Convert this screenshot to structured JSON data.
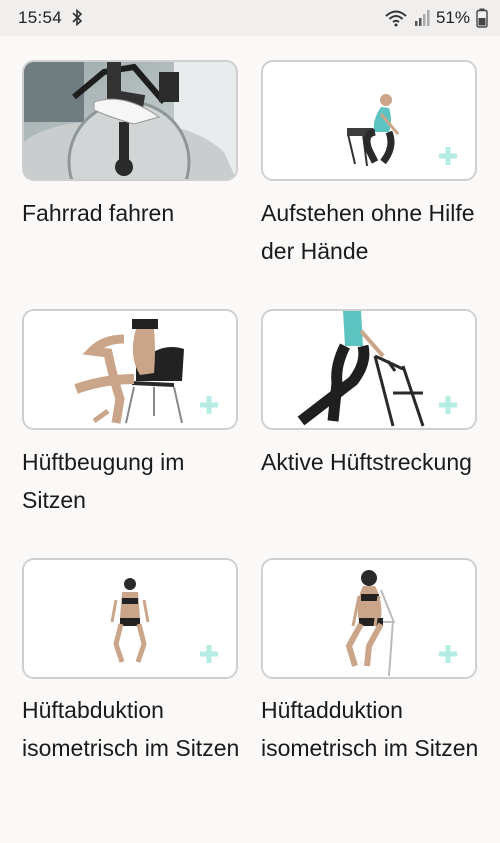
{
  "status_bar": {
    "time": "15:54",
    "battery_percent": "51%",
    "icons": [
      "bluetooth-icon",
      "wifi-icon",
      "signal-icon",
      "battery-icon"
    ]
  },
  "exercises": [
    {
      "title": "Fahrrad fahren",
      "image": "exercise-bike-photo"
    },
    {
      "title": "Aufstehen ohne Hilfe der Hände",
      "image": "woman-standing-from-chair"
    },
    {
      "title": "Hüftbeugung im Sitzen",
      "image": "woman-seated-hip-flexion"
    },
    {
      "title": "Aktive Hüftstreckung",
      "image": "woman-hip-extension-with-chair"
    },
    {
      "title": "Hüftabduktion isometrisch im Sitzen",
      "image": "woman-seated-abduction"
    },
    {
      "title": "Hüftadduktion isometrisch im Sitzen",
      "image": "woman-seated-adduction"
    }
  ],
  "colors": {
    "plus_accent": "#b5ece4",
    "card_border": "#cfcfcf"
  }
}
